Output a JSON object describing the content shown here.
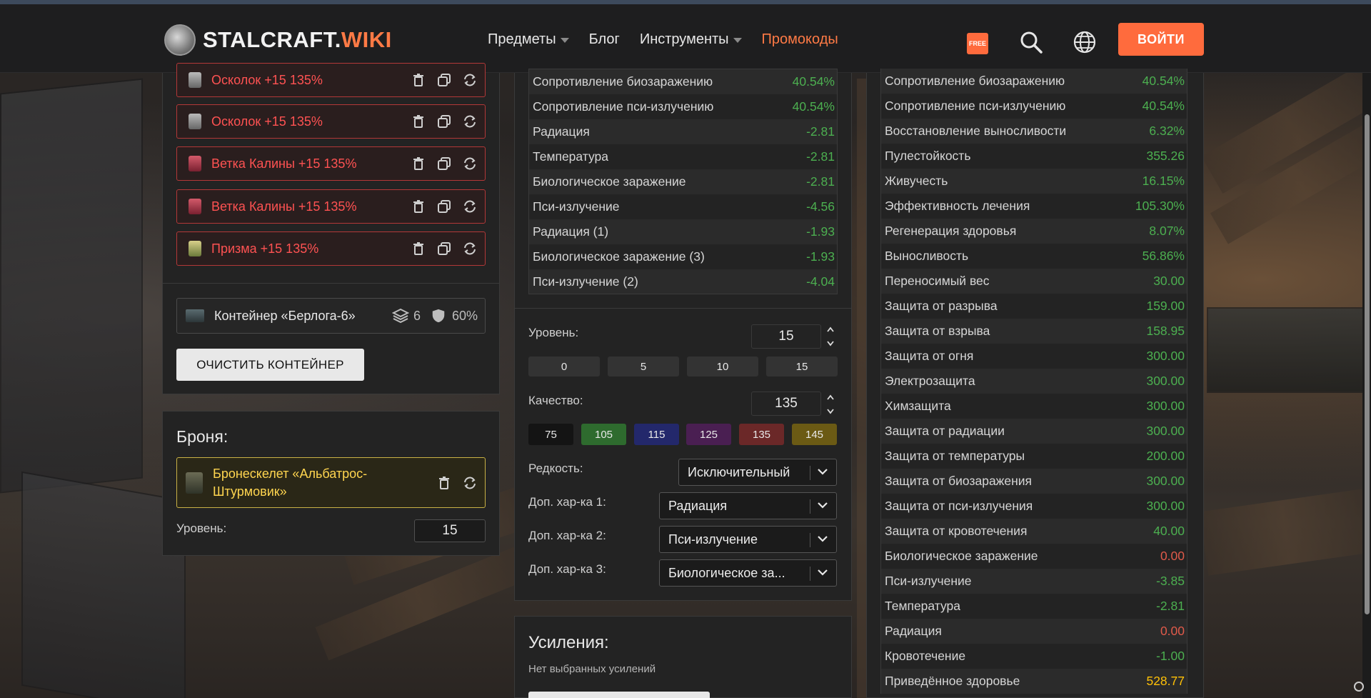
{
  "nav": {
    "logo_main": "STALCRAFT.",
    "logo_accent": "WIKI",
    "items": [
      {
        "label": "Предметы",
        "dropdown": true
      },
      {
        "label": "Блог",
        "dropdown": false
      },
      {
        "label": "Инструменты",
        "dropdown": true
      },
      {
        "label": "Промокоды",
        "dropdown": false
      }
    ],
    "free_badge": "FREE",
    "login": "ВОЙТИ"
  },
  "artifacts": [
    {
      "label": "Осколок +15 135%",
      "icon": "shard-icon"
    },
    {
      "label": "Осколок +15 135%",
      "icon": "shard-icon"
    },
    {
      "label": "Ветка Калины +15 135%",
      "icon": "branch-icon"
    },
    {
      "label": "Ветка Калины +15 135%",
      "icon": "branch-icon"
    },
    {
      "label": "Призма +15 135%",
      "icon": "prism-icon"
    }
  ],
  "container": {
    "name": "Контейнер «Берлога-6»",
    "slots": "6",
    "protection": "60%",
    "clear_button": "ОЧИСТИТЬ КОНТЕЙНЕР"
  },
  "armor": {
    "title": "Броня:",
    "name_line1": "Бронескелет «Альбатрос-",
    "name_line2": "Штурмовик»",
    "level_label": "Уровень:",
    "level_value": "15"
  },
  "artifact_stats": [
    {
      "name": "Сопротивление биозаражению",
      "value": "40.54%",
      "color": "#4caf50"
    },
    {
      "name": "Сопротивление пси-излучению",
      "value": "40.54%",
      "color": "#4caf50"
    },
    {
      "name": "Радиация",
      "value": "-2.81",
      "color": "#4caf50"
    },
    {
      "name": "Температура",
      "value": "-2.81",
      "color": "#4caf50"
    },
    {
      "name": "Биологическое заражение",
      "value": "-2.81",
      "color": "#4caf50"
    },
    {
      "name": "Пси-излучение",
      "value": "-4.56",
      "color": "#4caf50"
    },
    {
      "name": "Радиация (1)",
      "value": "-1.93",
      "color": "#4caf50"
    },
    {
      "name": "Биологическое заражение (3)",
      "value": "-1.93",
      "color": "#4caf50"
    },
    {
      "name": "Пси-излучение (2)",
      "value": "-4.04",
      "color": "#4caf50"
    }
  ],
  "artifact_settings": {
    "level_label": "Уровень:",
    "level_value": "15",
    "level_presets": [
      "0",
      "5",
      "10",
      "15"
    ],
    "quality_label": "Качество:",
    "quality_value": "135",
    "quality_presets": [
      {
        "label": "75",
        "color": "#141414"
      },
      {
        "label": "105",
        "color": "#2e6b2e"
      },
      {
        "label": "115",
        "color": "#23286b"
      },
      {
        "label": "125",
        "color": "#4a1f52"
      },
      {
        "label": "135",
        "color": "#6b2828"
      },
      {
        "label": "145",
        "color": "#6b5a14"
      }
    ],
    "rarity_label": "Редкость:",
    "rarity_value": "Исключительный",
    "extra1_label": "Доп. хар-ка 1:",
    "extra1_value": "Радиация",
    "extra2_label": "Доп. хар-ка 2:",
    "extra2_value": "Пси-излучение",
    "extra3_label": "Доп. хар-ка 3:",
    "extra3_value": "Биологическое за..."
  },
  "boosts": {
    "title": "Усиления:",
    "empty_text": "Нет выбранных усилений"
  },
  "total_stats": [
    {
      "name": "Сопротивление биозаражению",
      "value": "40.54%",
      "color": "#4caf50"
    },
    {
      "name": "Сопротивление пси-излучению",
      "value": "40.54%",
      "color": "#4caf50"
    },
    {
      "name": "Восстановление выносливости",
      "value": "6.32%",
      "color": "#4caf50"
    },
    {
      "name": "Пулестойкость",
      "value": "355.26",
      "color": "#4caf50"
    },
    {
      "name": "Живучесть",
      "value": "16.15%",
      "color": "#4caf50"
    },
    {
      "name": "Эффективность лечения",
      "value": "105.30%",
      "color": "#4caf50"
    },
    {
      "name": "Регенерация здоровья",
      "value": "8.07%",
      "color": "#4caf50"
    },
    {
      "name": "Выносливость",
      "value": "56.86%",
      "color": "#4caf50"
    },
    {
      "name": "Переносимый вес",
      "value": "30.00",
      "color": "#4caf50"
    },
    {
      "name": "Защита от разрыва",
      "value": "159.00",
      "color": "#4caf50"
    },
    {
      "name": "Защита от взрыва",
      "value": "158.95",
      "color": "#4caf50"
    },
    {
      "name": "Защита от огня",
      "value": "300.00",
      "color": "#4caf50"
    },
    {
      "name": "Электрозащита",
      "value": "300.00",
      "color": "#4caf50"
    },
    {
      "name": "Химзащита",
      "value": "300.00",
      "color": "#4caf50"
    },
    {
      "name": "Защита от радиации",
      "value": "300.00",
      "color": "#4caf50"
    },
    {
      "name": "Защита от температуры",
      "value": "200.00",
      "color": "#4caf50"
    },
    {
      "name": "Защита от биозаражения",
      "value": "300.00",
      "color": "#4caf50"
    },
    {
      "name": "Защита от пси-излучения",
      "value": "300.00",
      "color": "#4caf50"
    },
    {
      "name": "Защита от кровотечения",
      "value": "40.00",
      "color": "#4caf50"
    },
    {
      "name": "Биологическое заражение",
      "value": "0.00",
      "color": "#e05a4a"
    },
    {
      "name": "Пси-излучение",
      "value": "-3.85",
      "color": "#4caf50"
    },
    {
      "name": "Температура",
      "value": "-2.81",
      "color": "#4caf50"
    },
    {
      "name": "Радиация",
      "value": "0.00",
      "color": "#e05a4a"
    },
    {
      "name": "Кровотечение",
      "value": "-1.00",
      "color": "#4caf50"
    },
    {
      "name": "Приведённое здоровье",
      "value": "528.77",
      "color": "#ffc107"
    }
  ]
}
